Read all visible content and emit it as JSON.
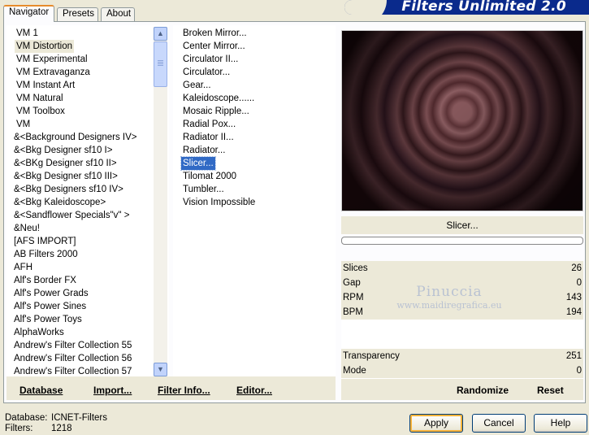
{
  "tabs": [
    "Navigator",
    "Presets",
    "About"
  ],
  "app_title": "Filters Unlimited 2.0",
  "categories": [
    "VM 1",
    "VM Distortion",
    "VM Experimental",
    "VM Extravaganza",
    "VM Instant Art",
    "VM Natural",
    "VM Toolbox",
    "VM",
    "&<Background Designers IV>",
    "&<Bkg Designer sf10 I>",
    "&<BKg Designer sf10 II>",
    "&<Bkg Designer sf10 III>",
    "&<Bkg Designers sf10 IV>",
    "&<Bkg Kaleidoscope>",
    "&<Sandflower Specials\"v\" >",
    "&Neu!",
    "[AFS IMPORT]",
    "AB Filters 2000",
    "AFH",
    "Alf's Border FX",
    "Alf's Power Grads",
    "Alf's Power Sines",
    "Alf's Power Toys",
    "AlphaWorks",
    "Andrew's Filter Collection 55",
    "Andrew's Filter Collection 56",
    "Andrew's Filter Collection 57"
  ],
  "selected_category": "VM Distortion",
  "filters": [
    "Broken Mirror...",
    "Center Mirror...",
    "Circulator II...",
    "Circulator...",
    "Gear...",
    "Kaleidoscope......",
    "Mosaic Ripple...",
    "Radial Pox...",
    "Radiator II...",
    "Radiator...",
    "Slicer...",
    "Tilomat 2000",
    "Tumbler...",
    "Vision Impossible"
  ],
  "selected_filter": "Slicer...",
  "preview_filter_name": "Slicer...",
  "params": [
    {
      "label": "Slices",
      "value": "26"
    },
    {
      "label": "Gap",
      "value": "0"
    },
    {
      "label": "RPM",
      "value": "143"
    },
    {
      "label": "BPM",
      "value": "194"
    },
    {
      "label": "Transparency",
      "value": "251"
    },
    {
      "label": "Mode",
      "value": "0"
    }
  ],
  "watermark": {
    "line1": "Pinuccia",
    "line2": "www.maidiregrafica.eu"
  },
  "bottom_buttons": {
    "database": "Database",
    "import": "Import...",
    "filter_info": "Filter Info...",
    "editor": "Editor..."
  },
  "right_buttons": {
    "randomize": "Randomize",
    "reset": "Reset"
  },
  "status": {
    "database_label": "Database:",
    "database_value": "ICNET-Filters",
    "filters_label": "Filters:",
    "filters_value": "1218"
  },
  "dialog_buttons": {
    "apply": "Apply",
    "cancel": "Cancel",
    "help": "Help"
  }
}
